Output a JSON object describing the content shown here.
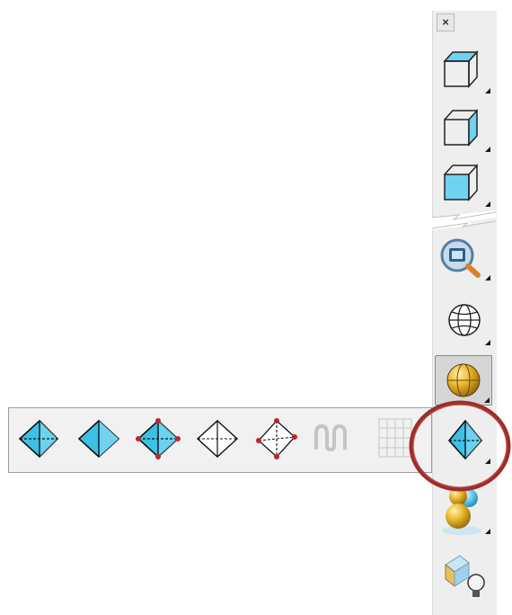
{
  "toolbar": {
    "close_label": "×",
    "tools": [
      {
        "name": "top-view-icon"
      },
      {
        "name": "front-view-icon"
      },
      {
        "name": "right-view-icon"
      },
      {
        "name": "zoom-extents-icon"
      },
      {
        "name": "wireframe-sphere-icon"
      },
      {
        "name": "shaded-sphere-icon",
        "active": true
      },
      {
        "name": "shaded-pyramid-icon"
      },
      {
        "name": "render-spheres-icon"
      },
      {
        "name": "lighting-icon"
      }
    ]
  },
  "flyout": {
    "items": [
      {
        "name": "shaded-pyramid-icon"
      },
      {
        "name": "flat-shaded-pyramid-icon"
      },
      {
        "name": "vertex-pyramid-icon"
      },
      {
        "name": "wireframe-pyramid-icon"
      },
      {
        "name": "vertex-wireframe-pyramid-icon"
      },
      {
        "name": "curve-icon",
        "disabled": true
      },
      {
        "name": "grid-icon",
        "disabled": true
      }
    ]
  },
  "colors": {
    "accent_blue": "#3cc0e6",
    "highlight_red": "#9d2d2a",
    "gold": "#d9a51a"
  }
}
